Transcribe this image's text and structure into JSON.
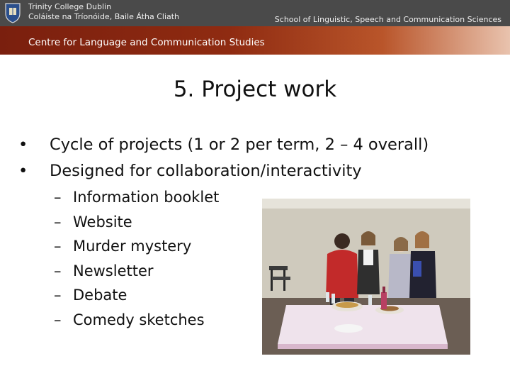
{
  "header": {
    "institution_line1": "Trinity College Dublin",
    "institution_line2": "Coláiste na Tríonóide, Baile Átha Cliath",
    "school": "School of Linguistic, Speech and Communication Sciences"
  },
  "banner": {
    "centre": "Centre for Language and Communication Studies"
  },
  "slide": {
    "title": "5. Project work",
    "bullets": [
      {
        "marker": "•",
        "text": "Cycle of projects (1 or 2 per term, 2 – 4 overall)"
      },
      {
        "marker": "•",
        "text": "Designed for collaboration/interactivity"
      }
    ],
    "subitems": [
      {
        "marker": "–",
        "text": "Information booklet"
      },
      {
        "marker": "–",
        "text": "Website"
      },
      {
        "marker": "–",
        "text": "Murder mystery"
      },
      {
        "marker": "–",
        "text": "Newsletter"
      },
      {
        "marker": "–",
        "text": "Debate"
      },
      {
        "marker": "–",
        "text": "Comedy sketches"
      }
    ]
  },
  "colors": {
    "header_bg": "#4a4a4a",
    "banner_red": "#8f2b11",
    "text": "#111111"
  },
  "icons": {
    "crest": "college-crest-icon"
  }
}
